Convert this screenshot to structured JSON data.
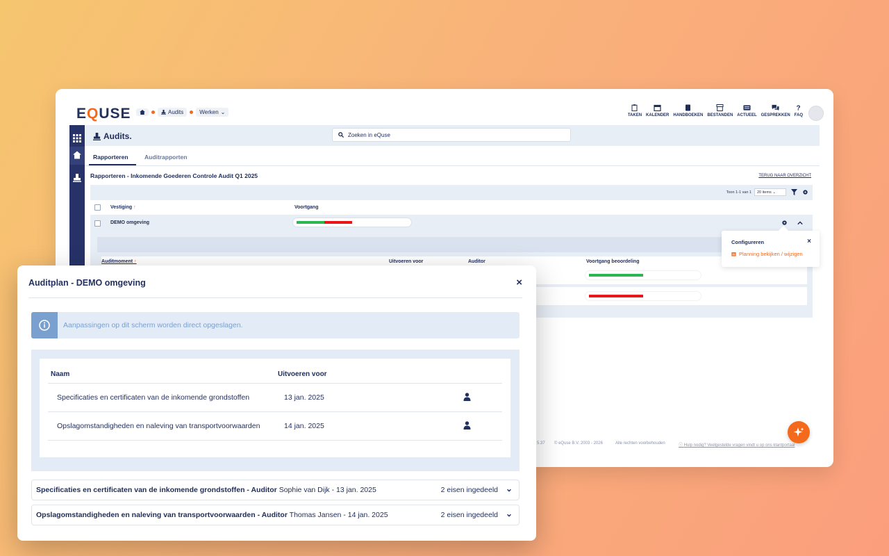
{
  "app": {
    "logo": {
      "prefix": "E",
      "q": "Q",
      "suffix": "USE"
    },
    "breadcrumb": {
      "audits": "Audits",
      "werken": "Werken"
    },
    "topnav": [
      {
        "label": "TAKEN",
        "icon": "clipboard-icon"
      },
      {
        "label": "KALENDER",
        "icon": "calendar-icon"
      },
      {
        "label": "HANDBOEKEN",
        "icon": "book-icon"
      },
      {
        "label": "BESTANDEN",
        "icon": "archive-icon"
      },
      {
        "label": "ACTUEEL",
        "icon": "news-icon"
      },
      {
        "label": "GESPREKKEN",
        "icon": "chat-icon"
      },
      {
        "label": "FAQ",
        "icon": "question-icon"
      }
    ],
    "page_title": "Audits.",
    "search_placeholder": "Zoeken in eQuse",
    "tabs": [
      "Rapporteren",
      "Auditrapporten"
    ],
    "report_title": "Rapporteren - Inkomende Goederen Controle Audit Q1 2025",
    "back_link": "TERUG NAAR OVERZICHT",
    "toolbar": {
      "count": "Toon 1-1 van 1",
      "per_page": "20 items"
    },
    "table": {
      "col_vestiging": "Vestiging",
      "col_voortgang": "Voortgang",
      "rows": [
        {
          "vestiging": "DEMO omgeving",
          "progress_green": 0.25,
          "progress_red": 0.25
        }
      ]
    },
    "subtable": {
      "col_auditmoment": "Auditmoment",
      "col_uitvoeren": "Uitvoeren voor",
      "col_auditor": "Auditor",
      "col_beoordeling": "Voortgang beoordeling",
      "rows": [
        {
          "beoordeling_fill": 0.5,
          "color": "#2bb653"
        },
        {
          "beoordeling_fill": 0.5,
          "color": "#e8151b"
        }
      ]
    },
    "footer": {
      "version": "5.37",
      "copyright": "© eQuse B.V. 2003 - 2026",
      "rights": "Alle rechten voorbehouden",
      "help": "Hulp nodig? Veelgestelde vragen vindt u op ons klantportaal"
    },
    "popover": {
      "title": "Configureren",
      "link": "Planning bekijken / wijzigen"
    }
  },
  "modal": {
    "title": "Auditplan - DEMO omgeving",
    "info": "Aanpassingen op dit scherm worden direct opgeslagen.",
    "col_naam": "Naam",
    "col_uitvoeren": "Uitvoeren voor",
    "rows": [
      {
        "naam": "Specificaties en certificaten van de inkomende grondstoffen",
        "datum": "13 jan. 2025"
      },
      {
        "naam": "Opslagomstandigheden en naleving van transportvoorwaarden",
        "datum": "14 jan. 2025"
      }
    ],
    "accordions": [
      {
        "title": "Specificaties en certificaten van de inkomende grondstoffen",
        "auditor_label": "- Auditor",
        "auditor": "Sophie van Dijk",
        "date": "- 13 jan. 2025",
        "eisen": "2 eisen ingedeeld"
      },
      {
        "title": "Opslagomstandigheden en naleving van transportvoorwaarden",
        "auditor_label": "- Auditor",
        "auditor": "Thomas Jansen",
        "date": "- 14 jan. 2025",
        "eisen": "2 eisen ingedeeld"
      }
    ]
  },
  "colors": {
    "accent": "#f36a1d",
    "navy": "#1f2d5a",
    "green": "#2bb653",
    "red": "#e8151b"
  }
}
